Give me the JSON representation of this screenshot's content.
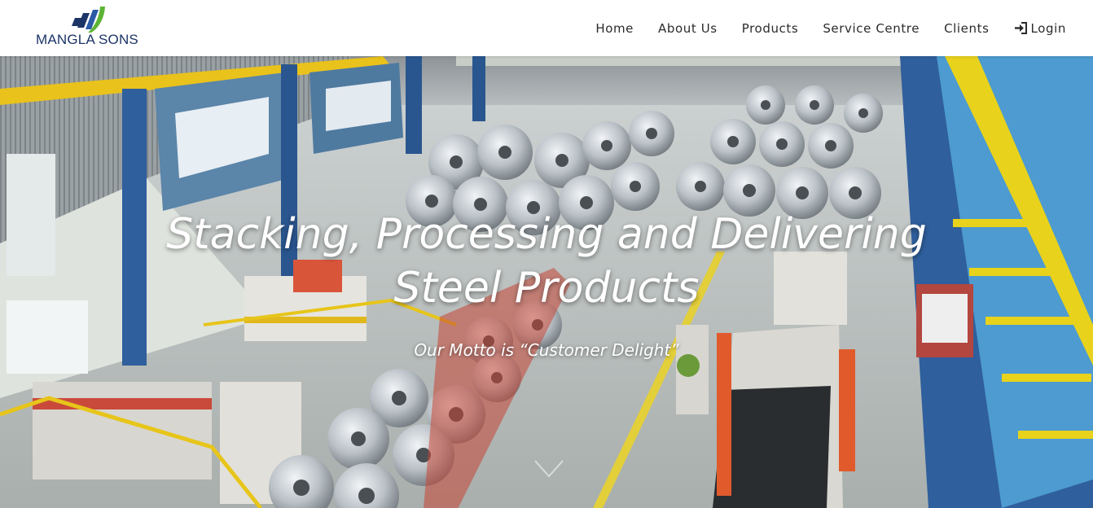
{
  "brand": {
    "name": "MANGLA SONS",
    "icon": "brand-logo-mark",
    "colors": {
      "navy": "#1c3466",
      "green": "#5cb434"
    }
  },
  "nav": {
    "items": [
      {
        "label": "Home"
      },
      {
        "label": "About Us"
      },
      {
        "label": "Products"
      },
      {
        "label": "Service Centre"
      },
      {
        "label": "Clients"
      },
      {
        "label": "Login",
        "icon": "sign-in-icon"
      }
    ]
  },
  "hero": {
    "title_line1": "Stacking, Processing and Delivering",
    "title_line2": "Steel Products",
    "motto": "Our Motto is “Customer Delight”",
    "scroll_icon": "chevron-down-icon",
    "background": "steel-coil-warehouse-photo"
  }
}
